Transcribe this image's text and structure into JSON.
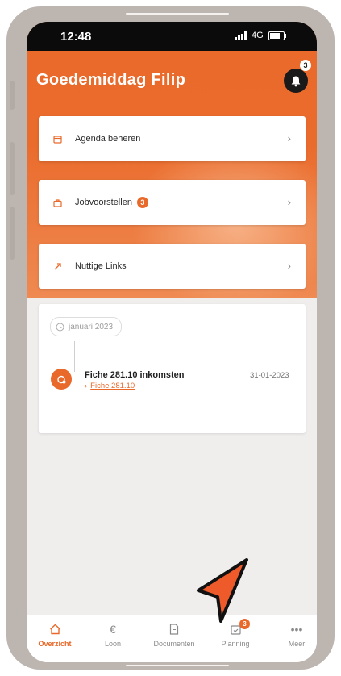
{
  "status_bar": {
    "time": "12:48",
    "network": "4G"
  },
  "header": {
    "greeting": "Goedemiddag Filip",
    "notification_count": "3"
  },
  "cards": [
    {
      "label": "Agenda beheren",
      "icon": "calendar-icon"
    },
    {
      "label": "Jobvoorstellen",
      "badge": "3",
      "icon": "briefcase-icon"
    },
    {
      "label": "Nuttige Links",
      "icon": "link-icon"
    }
  ],
  "timeline": {
    "month": "januari 2023",
    "item": {
      "title": "Fiche 281.10 inkomsten",
      "link": "Fiche 281.10",
      "date": "31-01-2023"
    }
  },
  "tabbar": {
    "tabs": [
      {
        "label": "Overzicht",
        "icon": "home-icon",
        "active": true
      },
      {
        "label": "Loon",
        "icon": "euro-icon"
      },
      {
        "label": "Documenten",
        "icon": "document-icon"
      },
      {
        "label": "Planning",
        "icon": "calendar-check-icon",
        "badge": "3"
      },
      {
        "label": "Meer",
        "icon": "more-icon"
      }
    ]
  },
  "colors": {
    "brand": "#e9692a",
    "frame": "#bcb5b0",
    "annotation_arrow": "#ee5a2a"
  }
}
